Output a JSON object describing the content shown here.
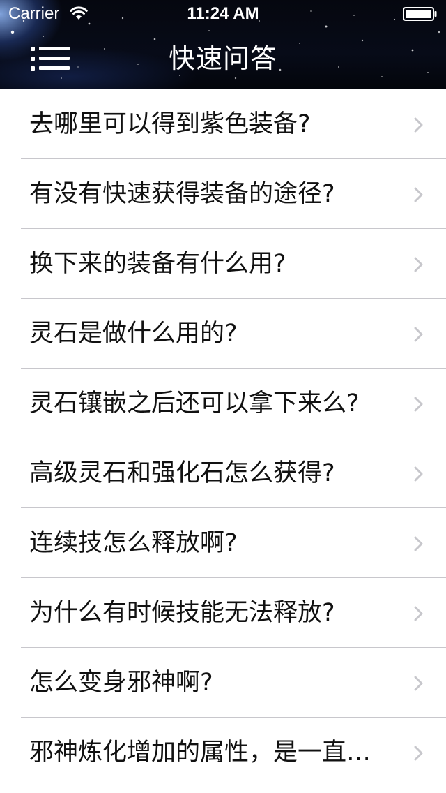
{
  "status_bar": {
    "carrier": "Carrier",
    "time": "11:24 AM",
    "wifi_icon": "wifi-icon",
    "battery_icon": "battery-icon"
  },
  "nav": {
    "menu_icon": "hamburger-menu-icon",
    "title": "快速问答"
  },
  "list": {
    "items": [
      {
        "label": "去哪里可以得到紫色装备?"
      },
      {
        "label": "有没有快速获得装备的途径?"
      },
      {
        "label": "换下来的装备有什么用?"
      },
      {
        "label": "灵石是做什么用的?"
      },
      {
        "label": "灵石镶嵌之后还可以拿下来么?"
      },
      {
        "label": "高级灵石和强化石怎么获得?"
      },
      {
        "label": "连续技怎么释放啊?"
      },
      {
        "label": "为什么有时候技能无法释放?"
      },
      {
        "label": "怎么变身邪神啊?"
      },
      {
        "label": "邪神炼化增加的属性，是一直…"
      }
    ],
    "chevron_icon": "chevron-right-icon"
  },
  "colors": {
    "text": "#111111",
    "separator": "#c8c7cc",
    "chevron": "#c7c7cc",
    "header_text": "#ffffff"
  }
}
